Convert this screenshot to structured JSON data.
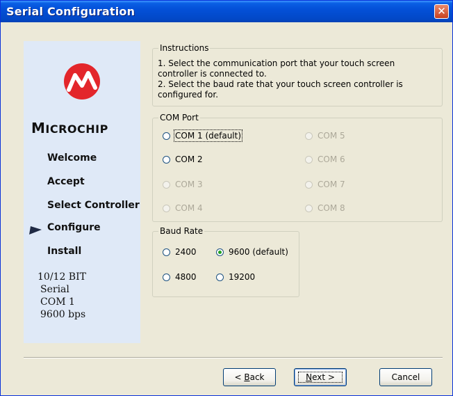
{
  "window": {
    "title": "Serial Configuration",
    "close_glyph": "✕"
  },
  "sidebar": {
    "logo_text_first": "M",
    "logo_text_rest": "ICROCHIP",
    "nav": [
      {
        "label": "Welcome",
        "current": false
      },
      {
        "label": "Accept",
        "current": false
      },
      {
        "label": "Select Controller",
        "current": false
      },
      {
        "label": "Configure",
        "current": true
      },
      {
        "label": "Install",
        "current": false
      }
    ],
    "info": [
      "10/12 BIT",
      "Serial",
      "COM 1",
      "9600 bps"
    ]
  },
  "instructions": {
    "legend": "Instructions",
    "line1": "1. Select the communication port that your touch screen controller is connected to.",
    "line2": "2. Select the baud rate that your touch screen controller is configured for."
  },
  "com_port": {
    "legend": "COM Port",
    "options": [
      {
        "label": "COM 1 (default)",
        "enabled": true,
        "checked": false
      },
      {
        "label": "COM 2",
        "enabled": true,
        "checked": false
      },
      {
        "label": "COM 3",
        "enabled": false,
        "checked": false
      },
      {
        "label": "COM 4",
        "enabled": false,
        "checked": false
      },
      {
        "label": "COM 5",
        "enabled": false,
        "checked": false
      },
      {
        "label": "COM 6",
        "enabled": false,
        "checked": false
      },
      {
        "label": "COM 7",
        "enabled": false,
        "checked": false
      },
      {
        "label": "COM 8",
        "enabled": false,
        "checked": false
      }
    ]
  },
  "baud_rate": {
    "legend": "Baud Rate",
    "options": [
      {
        "label": "2400",
        "checked": false
      },
      {
        "label": "9600 (default)",
        "checked": true
      },
      {
        "label": "4800",
        "checked": false
      },
      {
        "label": "19200",
        "checked": false
      }
    ]
  },
  "buttons": {
    "back_prefix": "< ",
    "back_mnemonic": "B",
    "back_rest": "ack",
    "next_mnemonic": "N",
    "next_rest": "ext >",
    "cancel": "Cancel"
  },
  "colors": {
    "title_bar": "#0350d8",
    "close_button": "#c8401f",
    "side_panel": "#dfe9f7",
    "logo_red": "#e3262b",
    "dialog_bg": "#ece9d8"
  }
}
